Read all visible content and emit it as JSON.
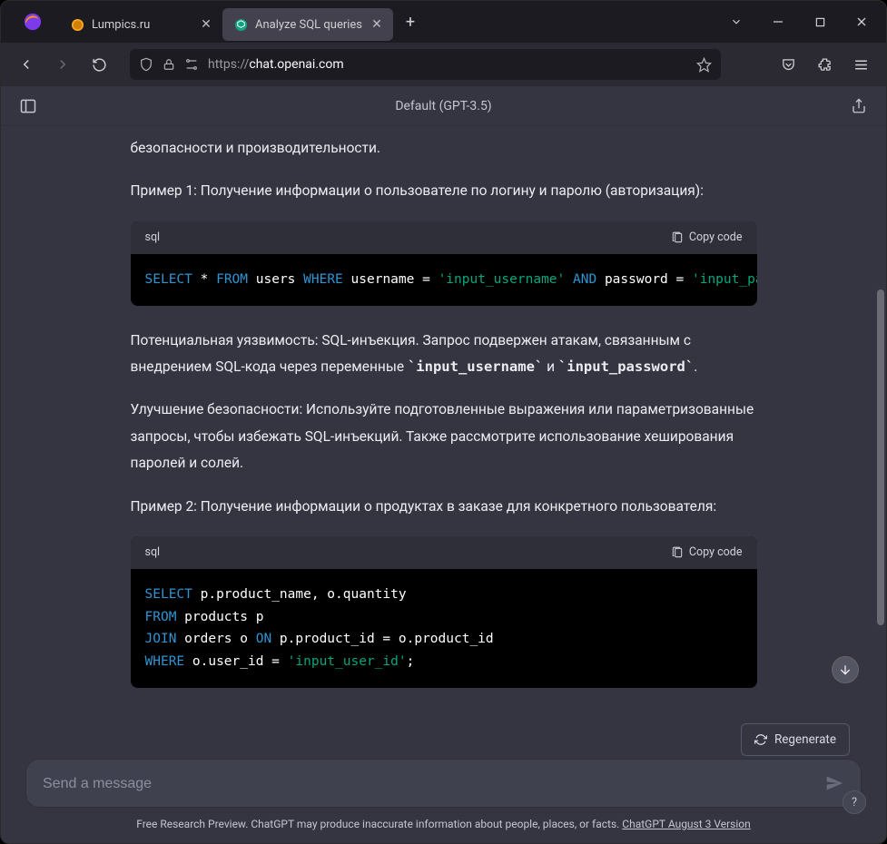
{
  "tabs": [
    {
      "label": "Lumpics.ru"
    },
    {
      "label": "Analyze SQL queries"
    }
  ],
  "url": {
    "prefix": "https://",
    "host": "chat.openai.com",
    "path": ""
  },
  "app": {
    "header_title": "Default (GPT-3.5)"
  },
  "content": {
    "p0": "безопасности и производительности.",
    "p1": "Пример 1: Получение информации о пользователе по логину и паролю (авторизация):",
    "code1": {
      "lang": "sql",
      "copy": "Copy code",
      "tokens": {
        "select": "SELECT",
        "star": "*",
        "from": "FROM",
        "users": "users",
        "where": "WHERE",
        "username": "username",
        "eq1": "=",
        "str1": "'input_username'",
        "and": "AND",
        "password": "password",
        "eq2": "=",
        "str2": "'input_pass"
      }
    },
    "p2a": "Потенциальная уязвимость: SQL-инъекция. Запрос подвержен атакам, связанным с внедрением SQL-кода через переменные ",
    "p2code1": "`input_username`",
    "p2mid": " и ",
    "p2code2": "`input_password`",
    "p2end": ".",
    "p3": "Улучшение безопасности: Используйте подготовленные выражения или параметризованные запросы, чтобы избежать SQL-инъекций. Также рассмотрите использование хеширования паролей и солей.",
    "p4": "Пример 2: Получение информации о продуктах в заказе для конкретного пользователя:",
    "code2": {
      "lang": "sql",
      "copy": "Copy code",
      "line1": {
        "select": "SELECT",
        "rest": " p.product_name, o.quantity"
      },
      "line2": {
        "from": "FROM",
        "rest": " products p"
      },
      "line3": {
        "join": "JOIN",
        "mid": " orders o ",
        "on": "ON",
        "rest": " p.product_id = o.product_id"
      },
      "line4": {
        "where": "WHERE",
        "mid": " o.user_id = ",
        "str": "'input_user_id'",
        "semi": ";"
      }
    }
  },
  "regenerate_label": "Regenerate",
  "input_placeholder": "Send a message",
  "footer": {
    "text": "Free Research Preview. ChatGPT may produce inaccurate information about people, places, or facts. ",
    "link": "ChatGPT August 3 Version"
  },
  "help_label": "?"
}
